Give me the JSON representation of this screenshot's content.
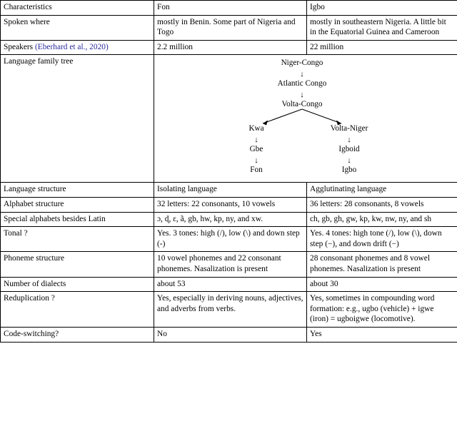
{
  "table": {
    "columns": [
      "Characteristics",
      "Fon",
      "Igbo"
    ],
    "rows": [
      {
        "characteristic": "Spoken where",
        "fon": "mostly in Benin. Some part of Nigeria and Togo",
        "igbo": "mostly in southeastern Nigeria. A little bit in the Equatorial Guinea and Cameroon"
      },
      {
        "characteristic_prefix": "Speakers ",
        "characteristic_citation": "(Eberhard et al., 2020)",
        "fon": "2.2 million",
        "igbo": "22 million"
      },
      {
        "characteristic": "Language family tree"
      },
      {
        "characteristic": "Language structure",
        "fon": "Isolating language",
        "igbo": "Agglutinating language"
      },
      {
        "characteristic": "Alphabet structure",
        "fon": "32 letters: 22 consonants, 10 vowels",
        "igbo": "36 letters: 28 consonants, 8 vowels"
      },
      {
        "characteristic": "Special alphabets besides Latin",
        "fon": "ɔ, ɖ, ɛ, ã, gb, hw, kp, ny, and xw.",
        "igbo": "ch, gb, gh, gw, kp, kw, nw, ny, and sh"
      },
      {
        "characteristic": "Tonal ?",
        "fon": "Yes. 3 tones: high (/), low (\\) and down step (-)",
        "igbo": "Yes. 4 tones: high tone (/), low (\\), down step (−), and down drift (−)"
      },
      {
        "characteristic": "Phoneme structure",
        "fon": "10 vowel phonemes and 22 consonant phonemes. Nasalization is present",
        "igbo": "28 consonant phonemes and 8 vowel phonemes. Nasalization is present"
      },
      {
        "characteristic": "Number of dialects",
        "fon": "about 53",
        "igbo": "about 30"
      },
      {
        "characteristic": "Reduplication ?",
        "fon": "Yes, especially in deriving nouns, adjectives, and adverbs from verbs.",
        "igbo": "Yes, sometimes in compounding word formation: e.g., ugbo (vehicle) + igwe (iron) = ugboigwe (locomotive)."
      },
      {
        "characteristic": "Code-switching?",
        "fon": "No",
        "igbo": "Yes"
      }
    ]
  },
  "family_tree": {
    "nodes": {
      "niger_congo": "Niger-Congo",
      "atlantic_congo": "Atlantic Congo",
      "volta_congo": "Volta-Congo",
      "kwa": "Kwa",
      "volta_niger": "Volta-Niger",
      "gbe": "Gbe",
      "igboid": "Igboid",
      "fon": "Fon",
      "igbo": "Igbo"
    },
    "arrow_glyph": "↓",
    "edges": [
      "Niger-Congo → Atlantic Congo",
      "Atlantic Congo → Volta-Congo",
      "Volta-Congo → Kwa",
      "Volta-Congo → Volta-Niger",
      "Kwa → Gbe",
      "Volta-Niger → Igboid",
      "Gbe → Fon",
      "Igboid → Igbo"
    ]
  },
  "colors": {
    "citation_link": "#2b2b9e",
    "rule": "#000000",
    "text": "#000000",
    "background": "#ffffff"
  }
}
